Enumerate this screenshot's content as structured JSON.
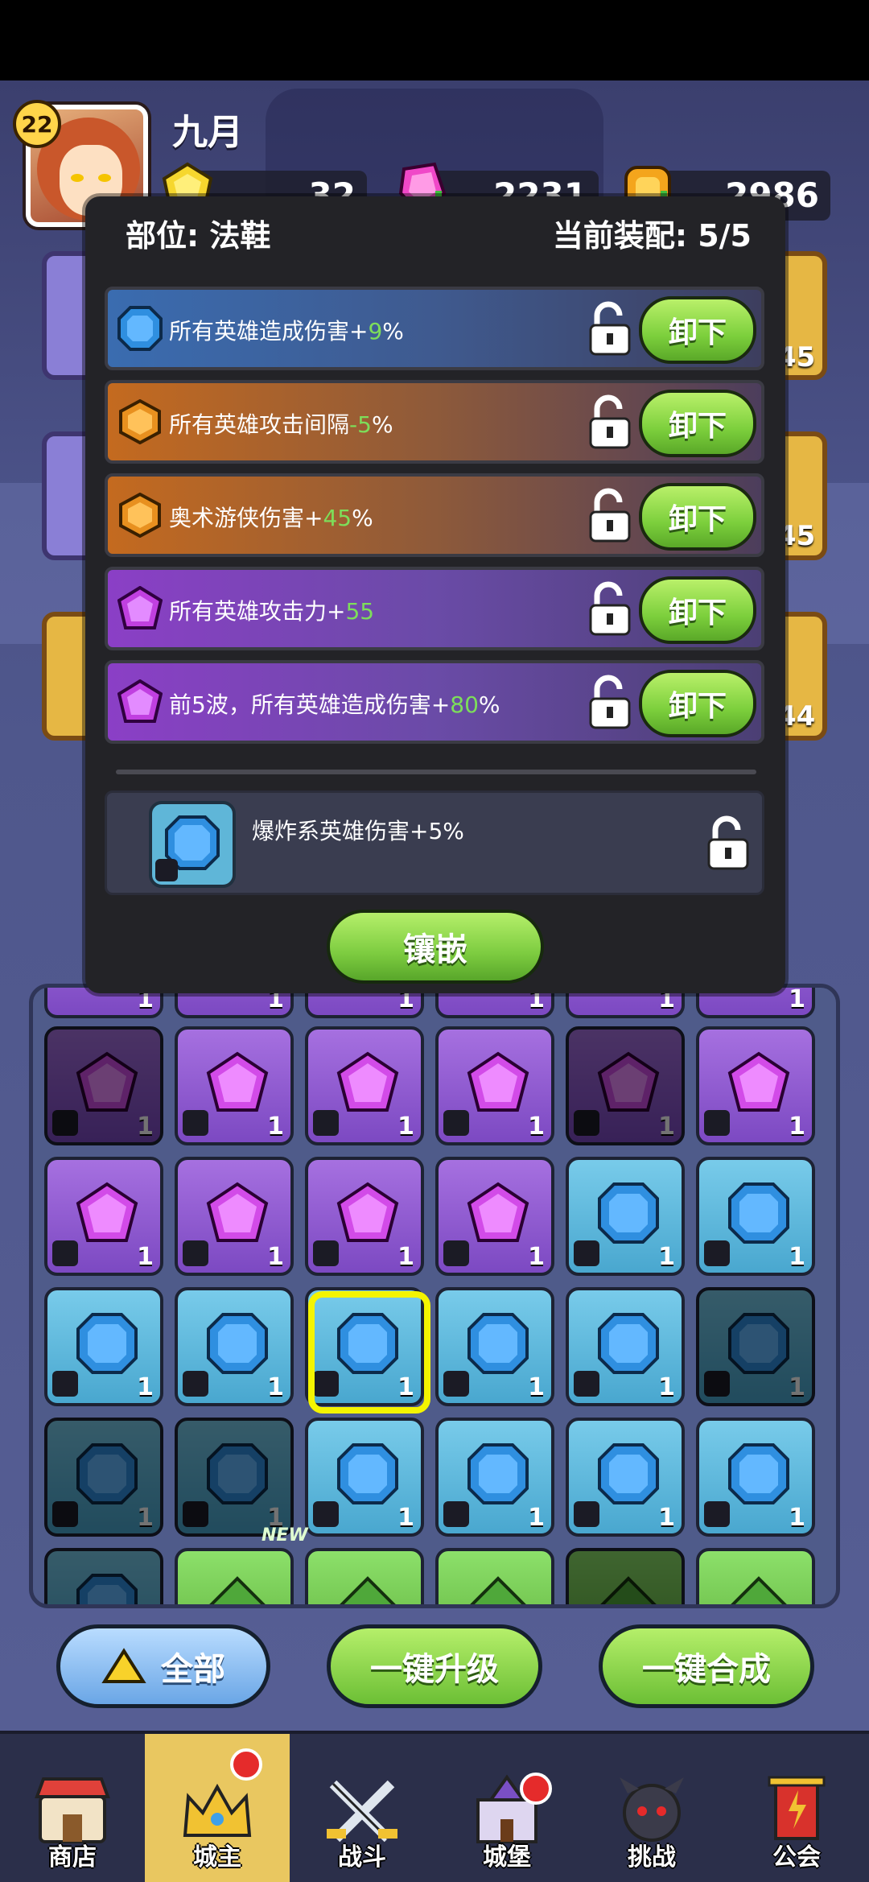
{
  "header": {
    "player_level": "22",
    "player_name": "九月",
    "currencies": [
      {
        "icon": "yellow-gem-icon",
        "value": "32"
      },
      {
        "icon": "pink-gem-icon",
        "value": "2231"
      },
      {
        "icon": "gold-coin-icon",
        "value": "2986"
      }
    ]
  },
  "background": {
    "side_slot_values": [
      "45",
      "45",
      "44"
    ]
  },
  "modal": {
    "slot_label": "部位: 法鞋",
    "equip_count": "当前装配: 5/5",
    "equipped": [
      {
        "color": "blue",
        "text": "所有英雄造成伤害+",
        "value": "9",
        "unit": "%",
        "button": "卸下"
      },
      {
        "color": "orange",
        "text": "所有英雄攻击间隔",
        "value": "-5",
        "unit": "%",
        "button": "卸下"
      },
      {
        "color": "orange",
        "text": "奥术游侠伤害+",
        "value": "45",
        "unit": "%",
        "button": "卸下"
      },
      {
        "color": "purple",
        "text": "所有英雄攻击力+",
        "value": "55",
        "unit": "",
        "button": "卸下"
      },
      {
        "color": "purple",
        "text": "前5波，所有英雄造成伤害+",
        "value": "80",
        "unit": "%",
        "button": "卸下"
      }
    ],
    "candidate": {
      "text": "爆炸系英雄伤害+5%"
    },
    "inlay_button": "镶嵌"
  },
  "inventory": {
    "count_label": "1",
    "new_tag": "NEW"
  },
  "controls": {
    "filter_label": "全部",
    "upgrade_label": "一键升级",
    "merge_label": "一键合成"
  },
  "nav": {
    "items": [
      {
        "label": "商店",
        "icon": "shop-icon"
      },
      {
        "label": "城主",
        "icon": "crown-icon",
        "active": true
      },
      {
        "label": "战斗",
        "icon": "crossed-swords-icon"
      },
      {
        "label": "城堡",
        "icon": "castle-icon"
      },
      {
        "label": "挑战",
        "icon": "demon-icon"
      },
      {
        "label": "公会",
        "icon": "guild-banner-icon"
      }
    ]
  },
  "colors": {
    "green_button": "#7ccf3c",
    "selected_border": "#f4f400",
    "positive_number": "#7dde5a"
  }
}
